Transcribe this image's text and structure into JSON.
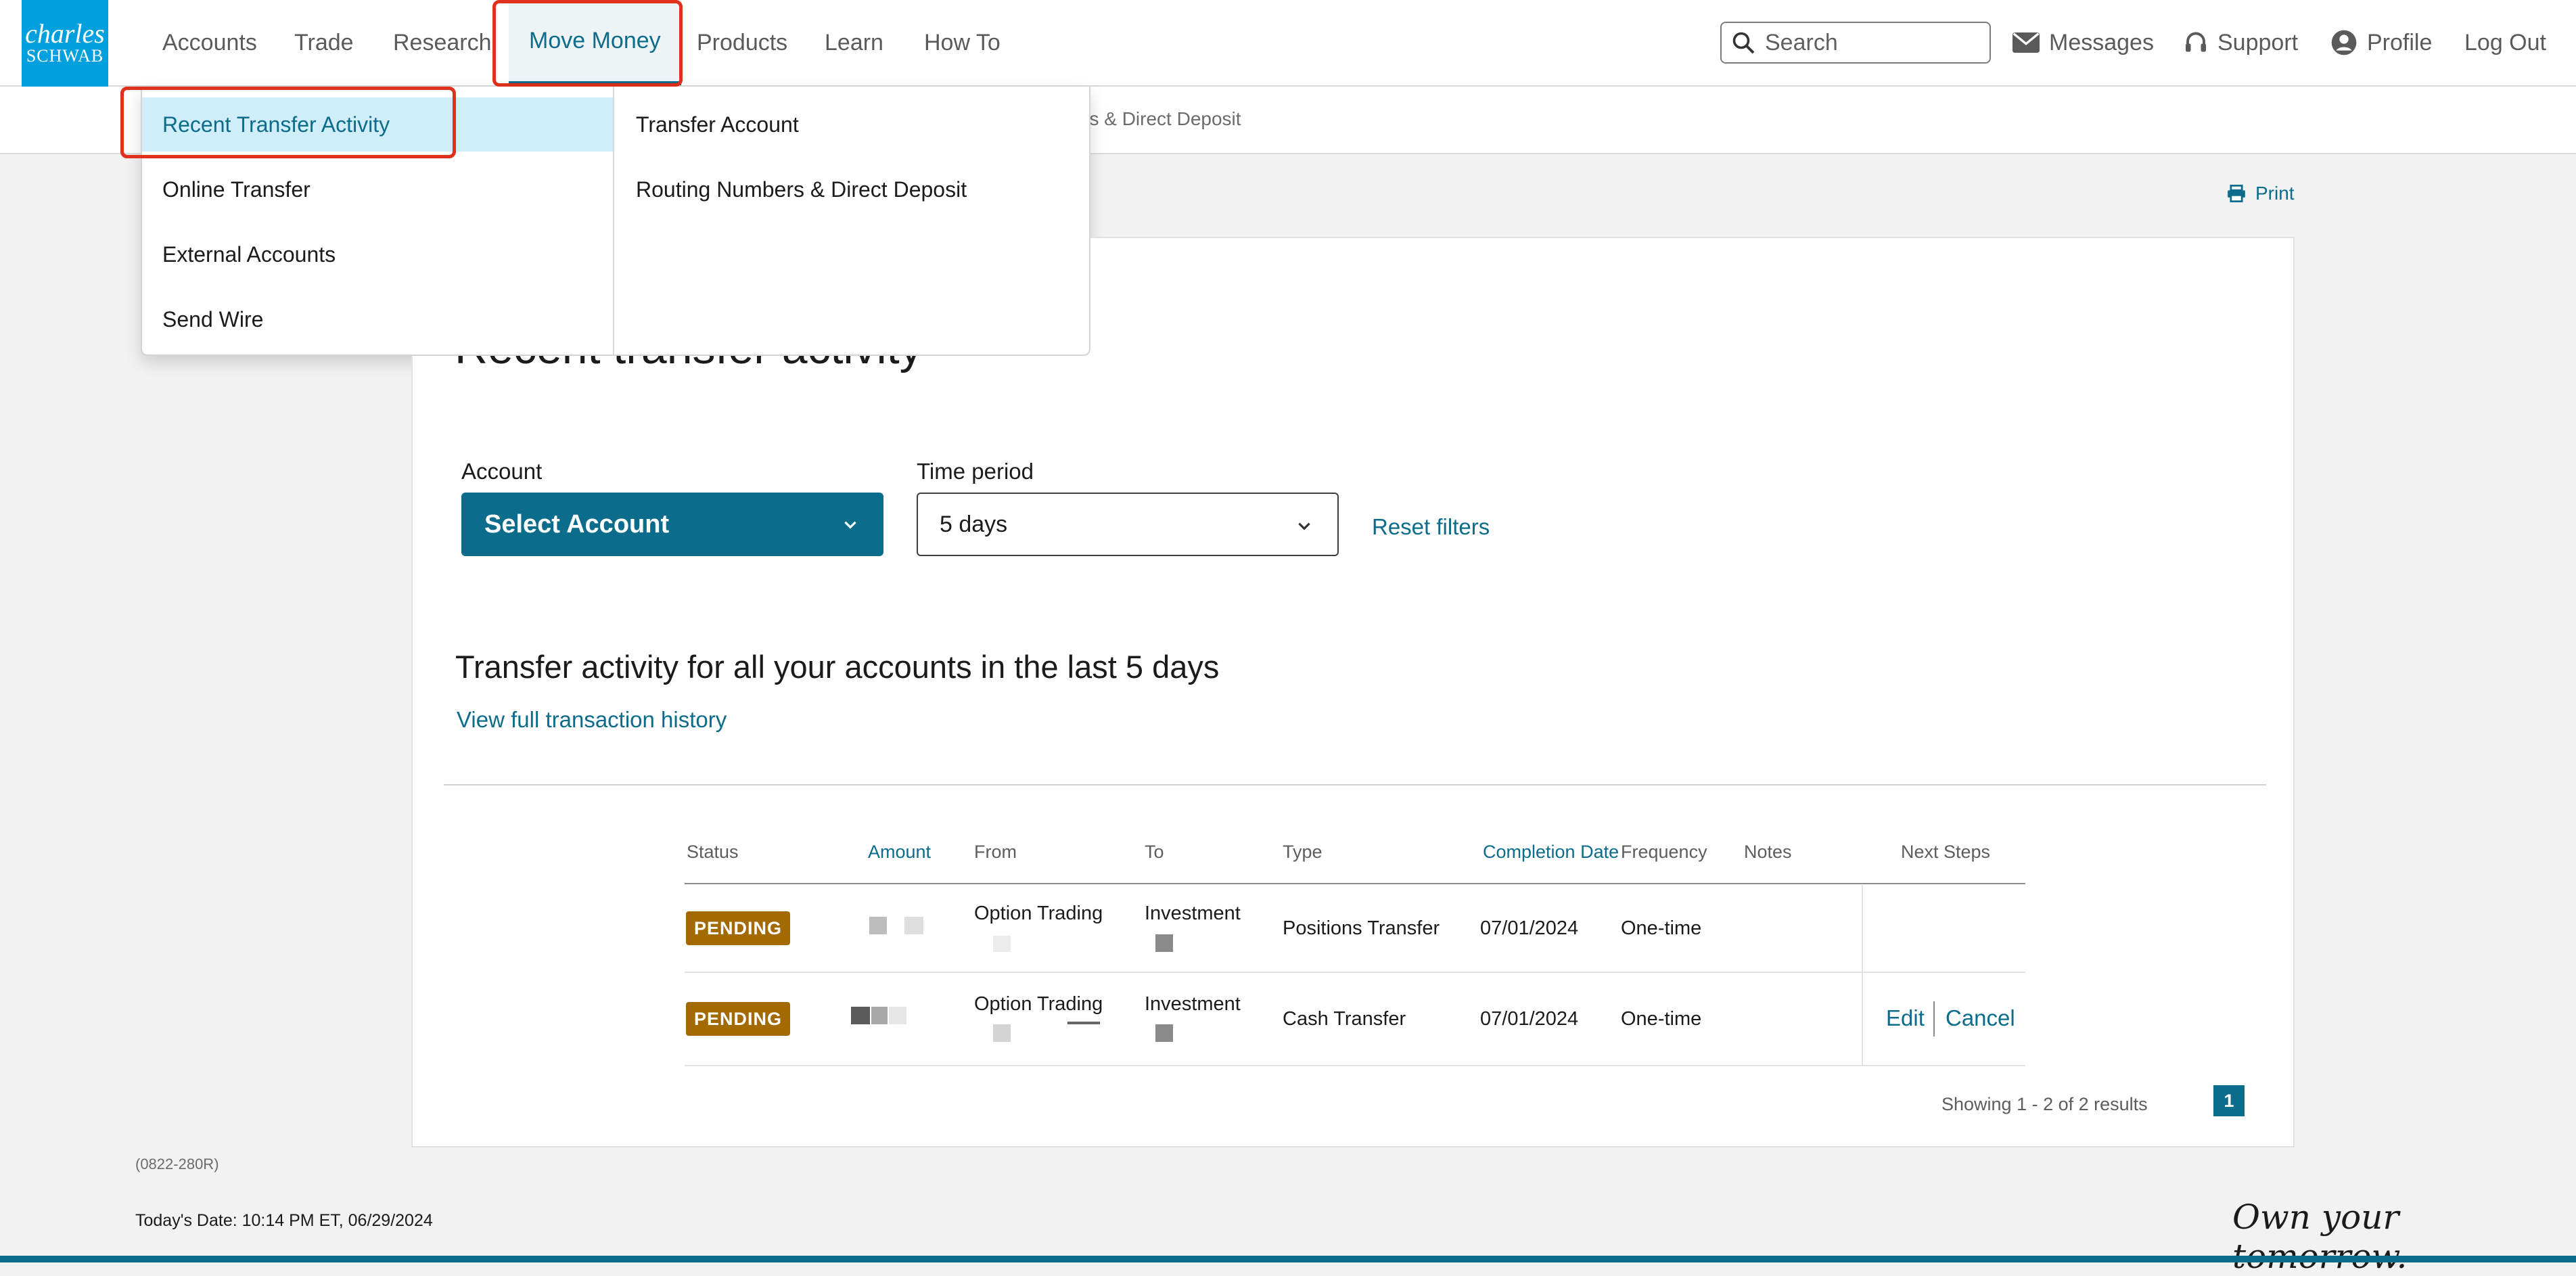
{
  "logo": {
    "line1": "charles",
    "line2": "SCHWAB"
  },
  "nav": {
    "items": [
      "Accounts",
      "Trade",
      "Research",
      "Move Money",
      "Products",
      "Learn",
      "How To"
    ],
    "active": "Move Money"
  },
  "search": {
    "placeholder": "Search"
  },
  "utility": {
    "messages": "Messages",
    "support": "Support",
    "profile": "Profile",
    "logout": "Log Out"
  },
  "subnav": {
    "partial_text": "bers & Direct Deposit"
  },
  "dropdown": {
    "column1": [
      "Recent Transfer Activity",
      "Online Transfer",
      "External Accounts",
      "Send Wire"
    ],
    "column2": [
      "Transfer Account",
      "Routing Numbers & Direct Deposit"
    ],
    "active": "Recent Transfer Activity"
  },
  "print": "Print",
  "page": {
    "title": "Recent transfer activity",
    "account_label": "Account",
    "account_value": "Select Account",
    "time_label": "Time period",
    "time_value": "5 days",
    "reset": "Reset filters",
    "heading": "Transfer activity for all your accounts in the last 5 days",
    "view_history": "View full transaction history"
  },
  "table": {
    "headers": [
      "Status",
      "Amount",
      "From",
      "To",
      "Type",
      "Completion Date",
      "Frequency",
      "Notes",
      "Next Steps"
    ],
    "rows": [
      {
        "status": "PENDING",
        "from": "Option Trading",
        "to": "Investment",
        "type": "Positions Transfer",
        "date": "07/01/2024",
        "frequency": "One-time",
        "actions": []
      },
      {
        "status": "PENDING",
        "from": "Option Trading",
        "to": "Investment",
        "type": "Cash Transfer",
        "date": "07/01/2024",
        "frequency": "One-time",
        "actions": [
          "Edit",
          "Cancel"
        ]
      }
    ],
    "showing": "Showing 1 - 2 of 2 results",
    "page": "1"
  },
  "footer": {
    "code": "(0822-280R)",
    "date": "Today's Date: 10:14 PM ET, 06/29/2024",
    "tagline": "Own your tomorrow."
  },
  "colors": {
    "brand": "#00a0df",
    "accent": "#0b6c8c",
    "pending": "#a26a00",
    "highlight": "#e0311d"
  }
}
